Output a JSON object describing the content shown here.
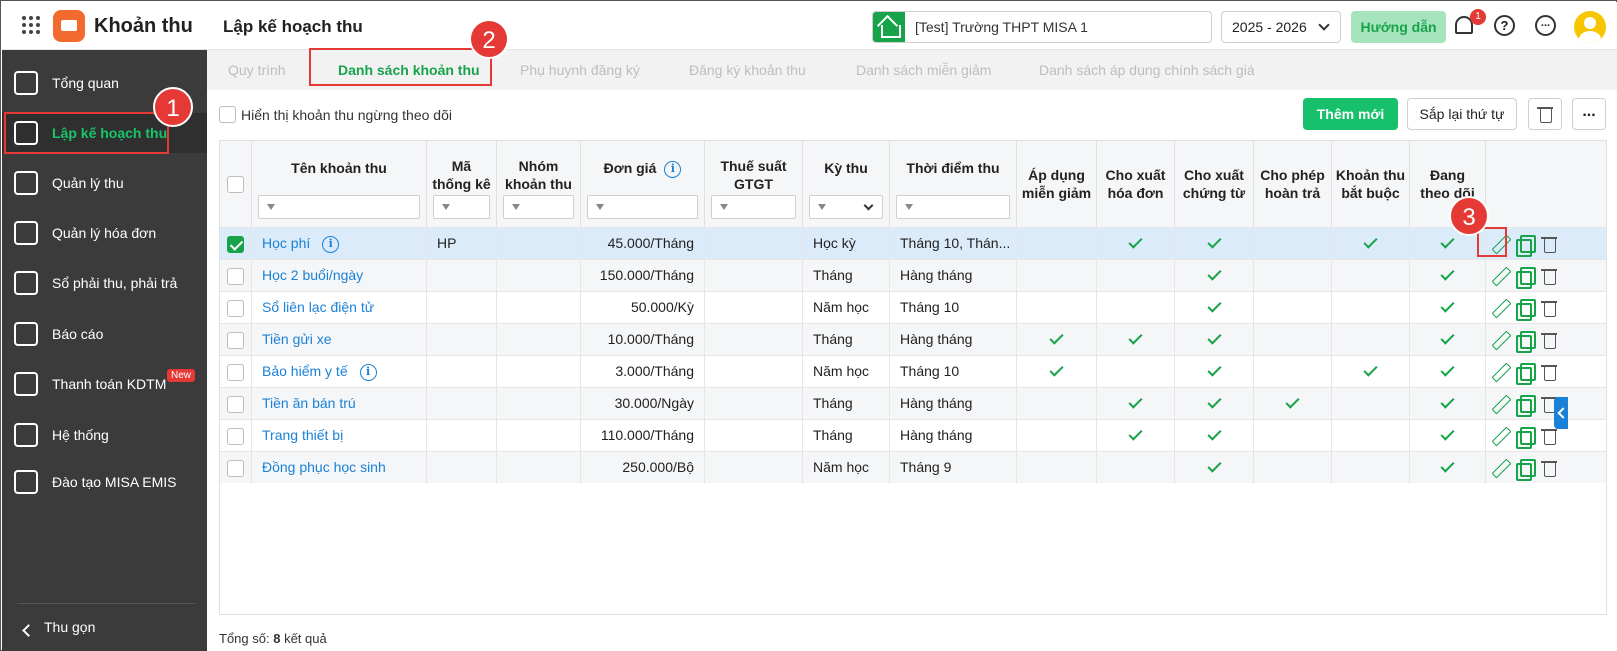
{
  "header": {
    "app_title": "Khoản thu",
    "page_title": "Lập kế hoạch thu",
    "school": "[Test] Trường THPT MISA 1",
    "year": "2025 - 2026",
    "guide_label": "Hướng dẫn",
    "notification_count": "1"
  },
  "sidebar": {
    "items": [
      {
        "label": "Tổng quan",
        "icon": "chart-icon"
      },
      {
        "label": "Lập kế hoạch thu",
        "icon": "calendar-money-icon",
        "active": true
      },
      {
        "label": "Quản lý thu",
        "icon": "hand-money-icon"
      },
      {
        "label": "Quản lý hóa đơn",
        "icon": "invoice-icon"
      },
      {
        "label": "Sổ phải thu, phải trả",
        "icon": "ledger-icon"
      },
      {
        "label": "Báo cáo",
        "icon": "pie-chart-icon"
      },
      {
        "label": "Thanh toán KDTM",
        "icon": "card-icon",
        "badge": "New"
      },
      {
        "label": "Hệ thống",
        "icon": "gear-icon"
      },
      {
        "label": "Đào tạo MISA EMIS",
        "icon": "book-icon"
      }
    ],
    "collapse_label": "Thu gọn"
  },
  "tabs": [
    {
      "label": "Quy trình"
    },
    {
      "label": "Danh sách khoản thu",
      "active": true
    },
    {
      "label": "Phụ huynh đăng ký"
    },
    {
      "label": "Đăng ký khoản thu"
    },
    {
      "label": "Danh sách miễn giảm"
    },
    {
      "label": "Danh sách áp dụng chính sách giá"
    }
  ],
  "toolbar": {
    "show_inactive_label": "Hiển thị khoản thu ngừng theo dõi",
    "add_label": "Thêm mới",
    "sort_label": "Sắp lại thứ tự"
  },
  "table": {
    "headers": {
      "name": "Tên khoản thu",
      "code_1": "Mã",
      "code_2": "thống kê",
      "group_1": "Nhóm",
      "group_2": "khoản thu",
      "price": "Đơn giá",
      "vat_1": "Thuế suất",
      "vat_2": "GTGT",
      "period": "Kỳ thu",
      "time": "Thời điểm thu",
      "discount_1": "Áp dụng",
      "discount_2": "miễn giảm",
      "invoice_1": "Cho xuất",
      "invoice_2": "hóa đơn",
      "receipt_1": "Cho xuất",
      "receipt_2": "chứng từ",
      "refund_1": "Cho phép",
      "refund_2": "hoàn trả",
      "required_1": "Khoản thu",
      "required_2": "bắt buộc",
      "tracking_1": "Đang",
      "tracking_2": "theo dõi"
    },
    "rows": [
      {
        "name": "Học phí",
        "info": true,
        "code": "HP",
        "group": "",
        "price": "45.000/Tháng",
        "vat": "",
        "period": "Học kỳ",
        "time": "Tháng 10, Thán...",
        "discount": false,
        "invoice": true,
        "receipt": true,
        "refund": false,
        "required": true,
        "tracking": true,
        "selected": true
      },
      {
        "name": "Học 2 buổi/ngày",
        "info": false,
        "code": "",
        "group": "",
        "price": "150.000/Tháng",
        "vat": "",
        "period": "Tháng",
        "time": "Hàng tháng",
        "discount": false,
        "invoice": false,
        "receipt": true,
        "refund": false,
        "required": false,
        "tracking": true
      },
      {
        "name": "Sổ liên lạc điện tử",
        "info": false,
        "code": "",
        "group": "",
        "price": "50.000/Kỳ",
        "vat": "",
        "period": "Năm học",
        "time": "Tháng 10",
        "discount": false,
        "invoice": false,
        "receipt": true,
        "refund": false,
        "required": false,
        "tracking": true
      },
      {
        "name": "Tiền gửi xe",
        "info": false,
        "code": "",
        "group": "",
        "price": "10.000/Tháng",
        "vat": "",
        "period": "Tháng",
        "time": "Hàng tháng",
        "discount": true,
        "invoice": true,
        "receipt": true,
        "refund": false,
        "required": false,
        "tracking": true
      },
      {
        "name": "Bảo hiểm y tế",
        "info": true,
        "code": "",
        "group": "",
        "price": "3.000/Tháng",
        "vat": "",
        "period": "Năm học",
        "time": "Tháng 10",
        "discount": true,
        "invoice": false,
        "receipt": true,
        "refund": false,
        "required": true,
        "tracking": true
      },
      {
        "name": "Tiền ăn bán trú",
        "info": false,
        "code": "",
        "group": "",
        "price": "30.000/Ngày",
        "vat": "",
        "period": "Tháng",
        "time": "Hàng tháng",
        "discount": false,
        "invoice": true,
        "receipt": true,
        "refund": true,
        "required": false,
        "tracking": true
      },
      {
        "name": "Trang thiết bị",
        "info": false,
        "code": "",
        "group": "",
        "price": "110.000/Tháng",
        "vat": "",
        "period": "Tháng",
        "time": "Hàng tháng",
        "discount": false,
        "invoice": true,
        "receipt": true,
        "refund": false,
        "required": false,
        "tracking": true
      },
      {
        "name": "Đồng phục học sinh",
        "info": false,
        "code": "",
        "group": "",
        "price": "250.000/Bộ",
        "vat": "",
        "period": "Năm học",
        "time": "Tháng 9",
        "discount": false,
        "invoice": false,
        "receipt": true,
        "refund": false,
        "required": false,
        "tracking": true
      }
    ]
  },
  "footer": {
    "total_prefix": "Tổng số:",
    "total_count": "8",
    "total_suffix": "kết quả"
  },
  "annotations": [
    "1",
    "2",
    "3"
  ],
  "colors": {
    "accent": "#17a34a",
    "link": "#1a82d6",
    "annotation": "#e53935",
    "sidebar": "#3b3b3b"
  }
}
